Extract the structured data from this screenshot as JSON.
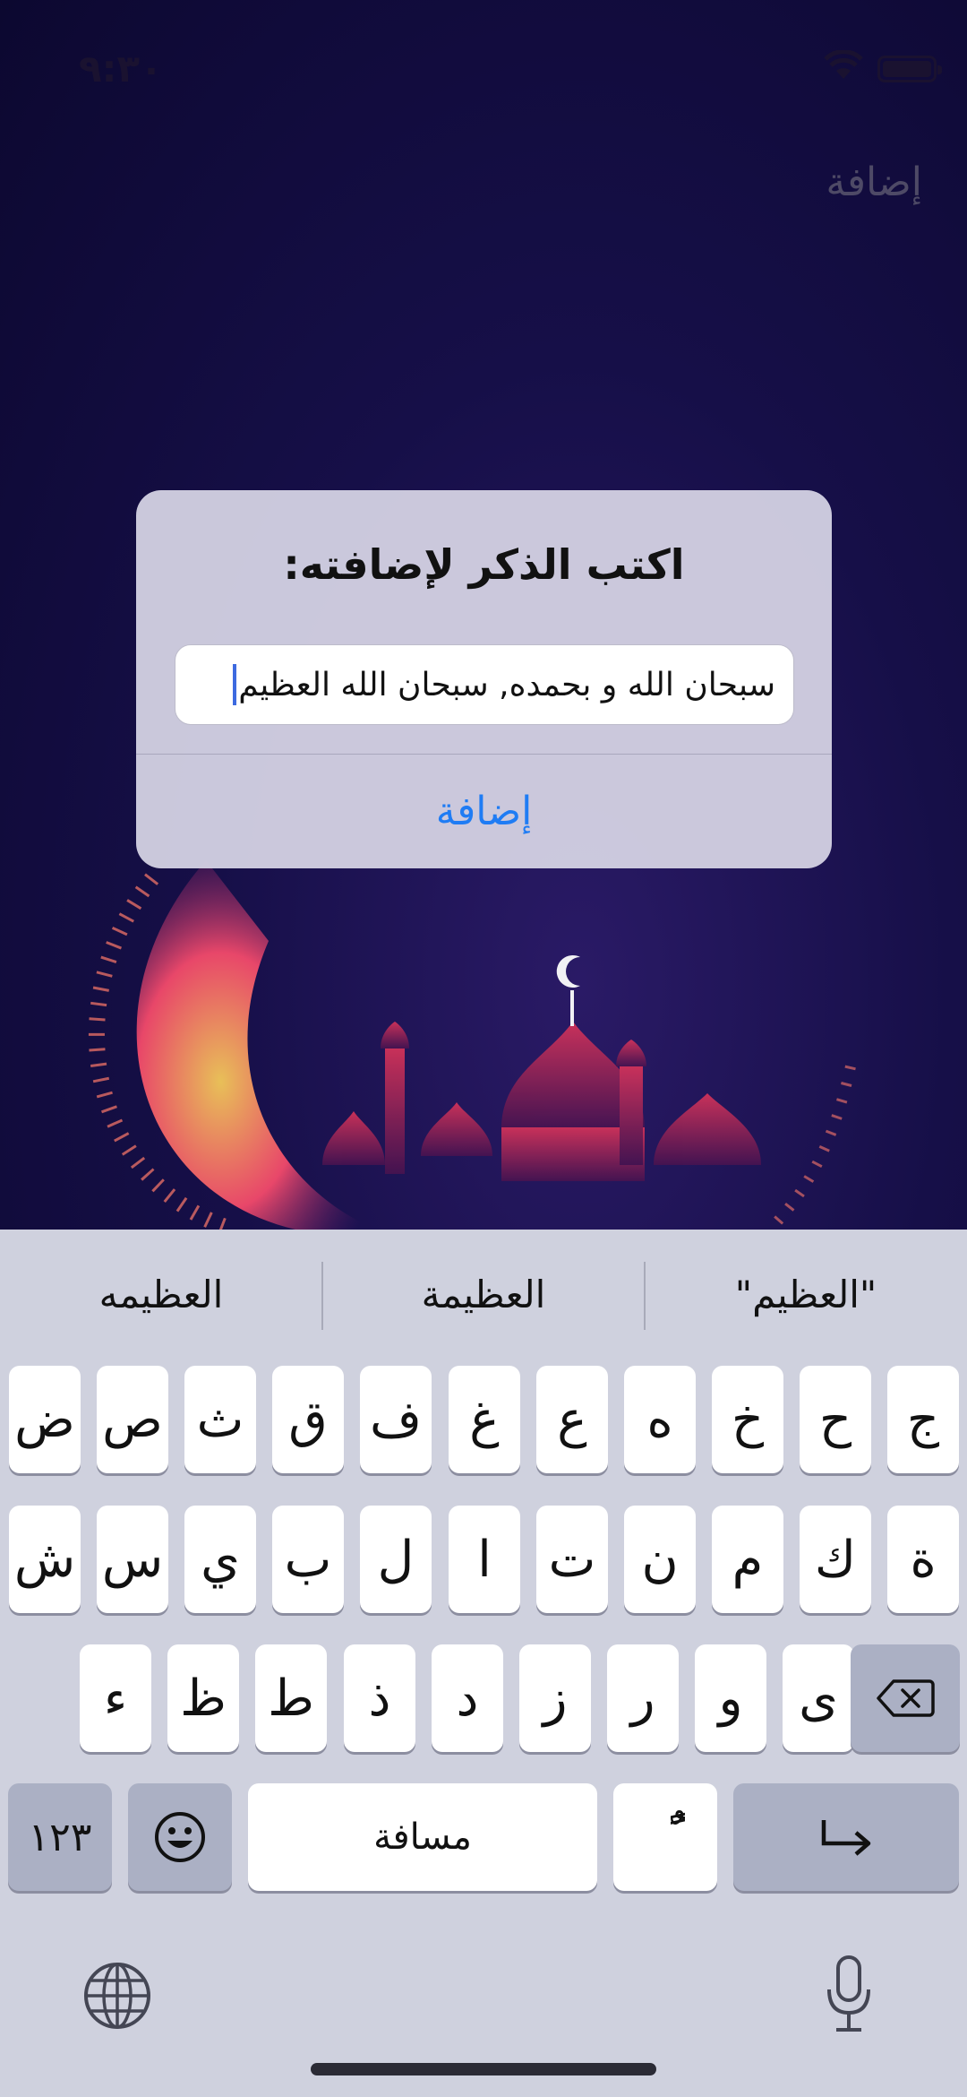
{
  "status_bar": {
    "time": "٩:٣٠"
  },
  "nav": {
    "add_label": "إضافة"
  },
  "alert": {
    "title": "اكتب الذكر لإضافته:",
    "input_value": "سبحان الله و بحمده, سبحان الله العظيم",
    "add_button": "إضافة"
  },
  "keyboard": {
    "suggestions": [
      "\"العظيم\"",
      "العظيمة",
      "العظيمه"
    ],
    "rows": [
      [
        "ج",
        "ح",
        "خ",
        "ه",
        "ع",
        "غ",
        "ف",
        "ق",
        "ث",
        "ص",
        "ض"
      ],
      [
        "ة",
        "ك",
        "م",
        "ن",
        "ت",
        "ا",
        "ل",
        "ب",
        "ي",
        "س",
        "ش"
      ],
      [
        "ى",
        "و",
        "ر",
        "ز",
        "د",
        "ذ",
        "ط",
        "ظ",
        "ء"
      ]
    ],
    "numbers_key": "١٢٣",
    "space_key": "مسافة",
    "tanween_key": "ًٌ",
    "return_icon": "return-arrow-icon",
    "backspace_icon": "backspace-icon",
    "emoji_icon": "emoji-icon",
    "globe_icon": "globe-icon",
    "mic_icon": "microphone-icon"
  },
  "colors": {
    "accent": "#1f7cf4",
    "background": "#0f0a36",
    "keyboard": "#cfd1de"
  }
}
